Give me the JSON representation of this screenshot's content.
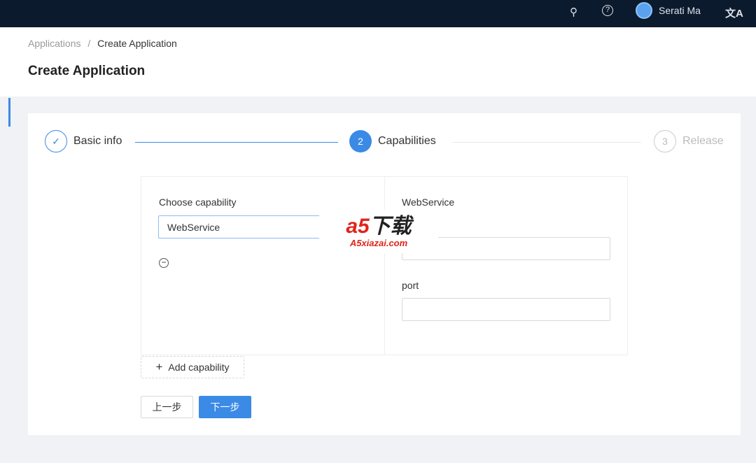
{
  "topbar": {
    "user": "Serati Ma",
    "icons": [
      "search-icon",
      "help-icon",
      "avatar",
      "translate-icon"
    ]
  },
  "breadcrumb": {
    "parent": "Applications",
    "sep": "/",
    "current": "Create Application"
  },
  "page_title": "Create Application",
  "steps": [
    {
      "label": "Basic info",
      "state": "done"
    },
    {
      "num": "2",
      "label": "Capabilities",
      "state": "active"
    },
    {
      "num": "3",
      "label": "Release",
      "state": "wait"
    }
  ],
  "form": {
    "choose_label": "Choose capability",
    "choose_value": "WebService",
    "right_title": "WebService",
    "port_label": "port",
    "field1_value": "",
    "port_value": ""
  },
  "buttons": {
    "add": "Add capability",
    "prev": "上一步",
    "next": "下一步"
  },
  "watermark": {
    "logo": "a5下载",
    "url": "A5xiazai.com"
  },
  "colors": {
    "primary": "#3b8ae6",
    "topbar": "#0c1a2e"
  }
}
